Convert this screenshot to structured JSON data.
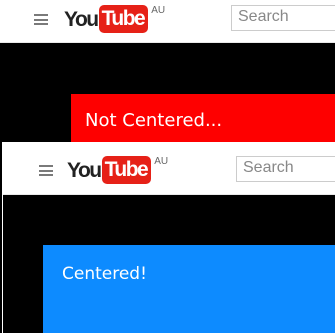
{
  "screenshot_top": {
    "menu_icon": "hamburger-icon",
    "logo": {
      "you": "You",
      "tube": "Tube",
      "country": "AU"
    },
    "search": {
      "placeholder": "Search"
    },
    "banner": {
      "text": "Not Centered...",
      "color": "#fe0000"
    }
  },
  "screenshot_bottom": {
    "menu_icon": "hamburger-icon",
    "logo": {
      "you": "You",
      "tube": "Tube",
      "country": "AU"
    },
    "search": {
      "placeholder": "Search"
    },
    "banner": {
      "text": "Centered!",
      "color": "#0d8bff"
    }
  },
  "colors": {
    "youtube_red": "#e62117",
    "background": "#000000",
    "header": "#ffffff"
  }
}
